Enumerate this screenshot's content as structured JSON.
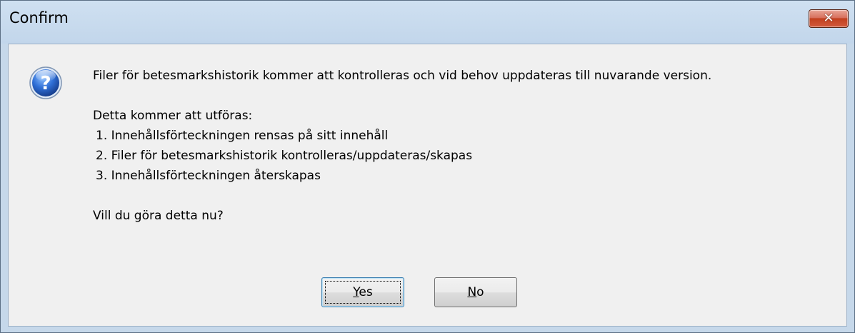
{
  "window": {
    "title": "Confirm",
    "close_icon": "close-icon"
  },
  "dialog": {
    "icon": "question-icon",
    "message": "Filer för betesmarkshistorik kommer att kontrolleras och vid behov uppdateras till nuvarande version.",
    "steps_heading": "Detta kommer att utföras:",
    "steps": [
      "1. Innehållsförteckningen rensas på sitt innehåll",
      "2. Filer för betesmarkshistorik kontrolleras/uppdateras/skapas",
      "3. Innehållsförteckningen återskapas"
    ],
    "question": "Vill du göra detta nu?"
  },
  "buttons": {
    "yes": {
      "mnemonic": "Y",
      "rest": "es"
    },
    "no": {
      "mnemonic": "N",
      "rest": "o"
    }
  },
  "colors": {
    "titlebar": "#c2d6eb",
    "client_bg": "#f0f0f0",
    "close_button": "#c2401f",
    "question_icon": "#1f5fc4"
  }
}
